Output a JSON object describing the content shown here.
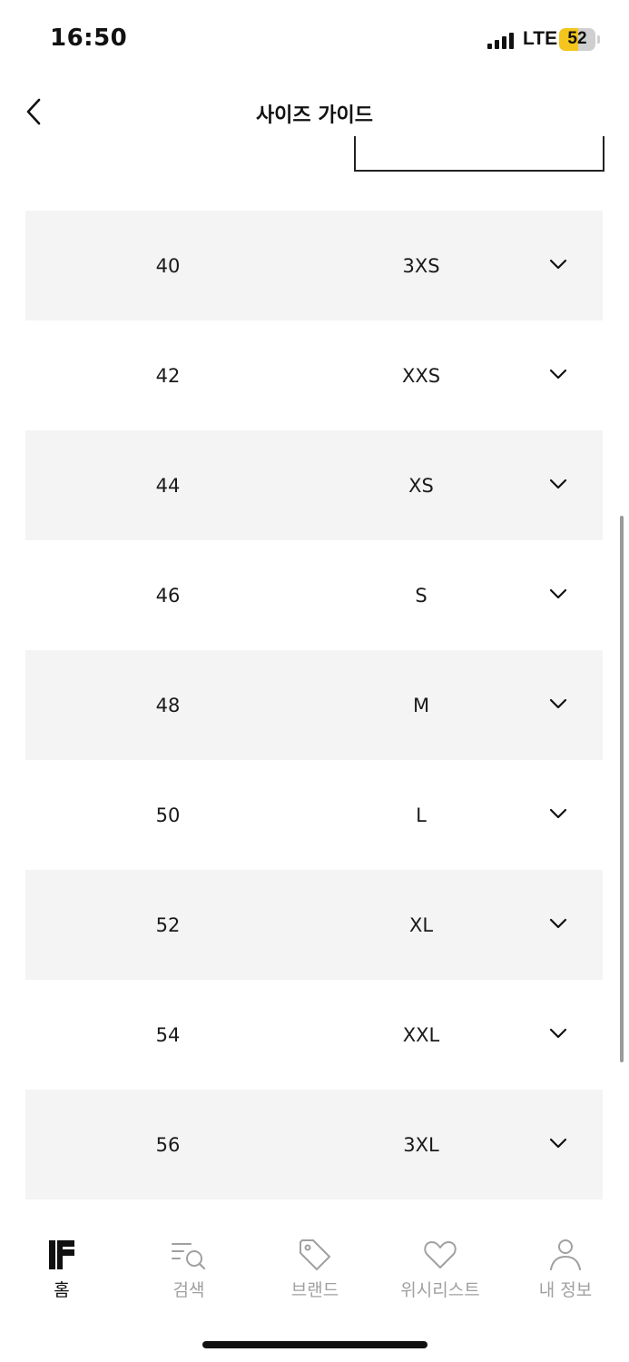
{
  "status_bar": {
    "time": "16:50",
    "network": "LTE",
    "battery": "52",
    "battery_fraction": 0.52,
    "battery_color": "#f4c51c"
  },
  "header": {
    "back_icon": "chevron-left-icon",
    "title": "사이즈 가이드"
  },
  "sizes": [
    {
      "eu": "40",
      "intl": "3XS"
    },
    {
      "eu": "42",
      "intl": "XXS"
    },
    {
      "eu": "44",
      "intl": "XS"
    },
    {
      "eu": "46",
      "intl": "S"
    },
    {
      "eu": "48",
      "intl": "M"
    },
    {
      "eu": "50",
      "intl": "L"
    },
    {
      "eu": "52",
      "intl": "XL"
    },
    {
      "eu": "54",
      "intl": "XXL"
    },
    {
      "eu": "56",
      "intl": "3XL"
    }
  ],
  "row_colors": {
    "shaded": "#f4f4f4",
    "plain": "#ffffff"
  },
  "bottom_nav": {
    "items": [
      {
        "label": "홈",
        "icon": "ff-logo-icon",
        "active": true
      },
      {
        "label": "검색",
        "icon": "search-icon",
        "active": false
      },
      {
        "label": "브랜드",
        "icon": "tag-icon",
        "active": false
      },
      {
        "label": "위시리스트",
        "icon": "heart-icon",
        "active": false
      },
      {
        "label": "내 정보",
        "icon": "user-icon",
        "active": false
      }
    ]
  }
}
